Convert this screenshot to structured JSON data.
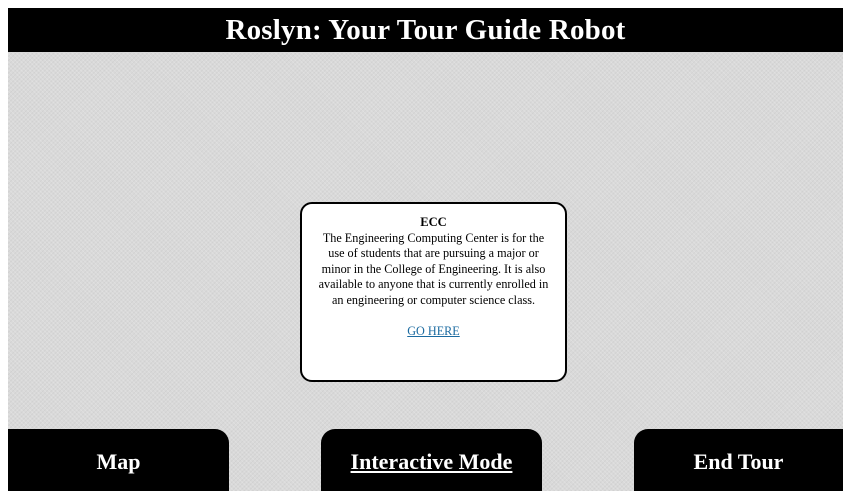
{
  "header": {
    "title": "Roslyn: Your Tour Guide Robot"
  },
  "info_card": {
    "title": "ECC",
    "description": "The Engineering Computing Center is for the use of students that are pursuing a major or minor in the College of Engineering. It is also available to anyone that is currently enrolled in an engineering or computer science class.",
    "link_label": "GO HERE",
    "link_color": "#1a6aa0"
  },
  "nav": {
    "map_label": "Map",
    "interactive_label": "Interactive Mode",
    "end_tour_label": "End Tour"
  },
  "colors": {
    "bar_background": "#000000",
    "bar_text": "#ffffff",
    "page_background": "#d9d9d9"
  }
}
